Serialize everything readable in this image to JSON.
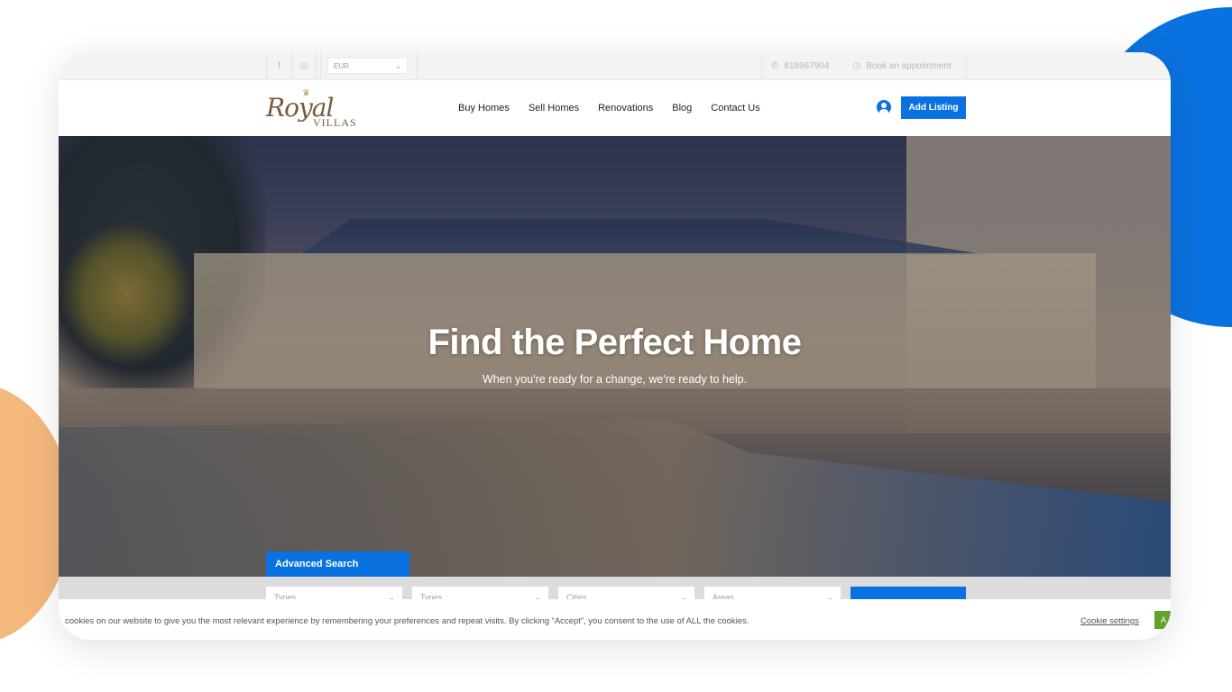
{
  "topbar": {
    "social": [
      {
        "icon": "facebook-icon",
        "glyph": "f"
      },
      {
        "icon": "instagram-icon",
        "glyph": "◎"
      }
    ],
    "currency": {
      "selected": "EUR",
      "chevron": "⌄"
    },
    "phone": {
      "icon": "whatsapp-icon",
      "glyph": "✆",
      "value": "618967904"
    },
    "appointment": {
      "icon": "clock-icon",
      "glyph": "◷",
      "label": "Book an appointment"
    }
  },
  "header": {
    "logo": {
      "crown": "♛",
      "top": "Royal",
      "bottom": "VILLAS"
    },
    "nav": [
      {
        "label": "Buy Homes"
      },
      {
        "label": "Sell Homes"
      },
      {
        "label": "Renovations"
      },
      {
        "label": "Blog"
      },
      {
        "label": "Contact Us"
      }
    ],
    "add_listing": "Add Listing"
  },
  "hero": {
    "title": "Find the Perfect Home",
    "subtitle": "When you're ready for a change, we're ready to help."
  },
  "search": {
    "tab_label": "Advanced Search",
    "selects": [
      {
        "placeholder": "Types"
      },
      {
        "placeholder": "Types"
      },
      {
        "placeholder": "Cities"
      },
      {
        "placeholder": "Areas"
      }
    ],
    "chevron": "⌄"
  },
  "cookie": {
    "text": "cookies on our website to give you the most relevant experience by remembering your preferences and repeat visits. By clicking “Accept”, you consent to the use of ALL the cookies.",
    "settings_label": "Cookie settings",
    "accept_label": "A"
  },
  "colors": {
    "accent": "#0a72e0",
    "accept": "#61a229",
    "blob_orange": "#f4b87c"
  }
}
